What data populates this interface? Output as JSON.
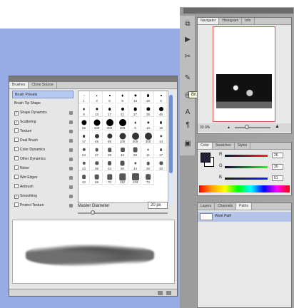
{
  "brushes_panel": {
    "tabs": [
      "Brushes",
      "Clone Source"
    ],
    "settings": [
      {
        "label": "Brush Presets",
        "checkbox": false,
        "selected": true,
        "locked": false
      },
      {
        "label": "Brush Tip Shape",
        "checkbox": false,
        "selected": false,
        "locked": false
      },
      {
        "label": "Shape Dynamics",
        "checkbox": true,
        "checked": true,
        "locked": true
      },
      {
        "label": "Scattering",
        "checkbox": true,
        "checked": true,
        "locked": true
      },
      {
        "label": "Texture",
        "checkbox": true,
        "checked": false,
        "locked": true
      },
      {
        "label": "Dual Brush",
        "checkbox": true,
        "checked": false,
        "locked": true
      },
      {
        "label": "Color Dynamics",
        "checkbox": true,
        "checked": false,
        "locked": true
      },
      {
        "label": "Other Dynamics",
        "checkbox": true,
        "checked": false,
        "locked": true
      },
      {
        "label": "Noise",
        "checkbox": true,
        "checked": false,
        "locked": true
      },
      {
        "label": "Wet Edges",
        "checkbox": true,
        "checked": false,
        "locked": true
      },
      {
        "label": "Airbrush",
        "checkbox": true,
        "checked": false,
        "locked": true
      },
      {
        "label": "Smoothing",
        "checkbox": true,
        "checked": true,
        "locked": true
      },
      {
        "label": "Protect Texture",
        "checkbox": true,
        "checked": false,
        "locked": true
      }
    ],
    "preset_numbers": [
      "1",
      "3",
      "5",
      "9",
      "13",
      "19",
      "5",
      "9",
      "13",
      "17",
      "21",
      "27",
      "35",
      "45",
      "65",
      "100",
      "200",
      "300",
      "9",
      "13",
      "19",
      "17",
      "45",
      "65",
      "100",
      "200",
      "300",
      "14",
      "24",
      "27",
      "39",
      "46",
      "59",
      "11",
      "17",
      "23",
      "36",
      "44",
      "60",
      "14",
      "26",
      "33",
      "42",
      "55",
      "70",
      "112",
      "134",
      "74"
    ],
    "master_diameter_label": "Master Diameter",
    "master_diameter_value": "20 px"
  },
  "navigator_panel": {
    "tabs": [
      "Navigator",
      "Histogram",
      "Info"
    ],
    "zoom": "33.9%"
  },
  "color_panel": {
    "tabs": [
      "Color",
      "Swatches",
      "Styles"
    ],
    "channels": [
      {
        "letter": "R",
        "value": "26"
      },
      {
        "letter": "G",
        "value": "30"
      },
      {
        "letter": "B",
        "value": "51"
      }
    ]
  },
  "layers_panel": {
    "tabs": [
      "Layers",
      "Channels",
      "Paths"
    ],
    "paths": [
      "Work Path"
    ]
  },
  "tooltip": "Brushes",
  "tools": [
    "history-icon",
    "actions-icon",
    "tool-presets-icon",
    "brushes-icon",
    "clone-icon",
    "character-icon",
    "paragraph-icon"
  ]
}
